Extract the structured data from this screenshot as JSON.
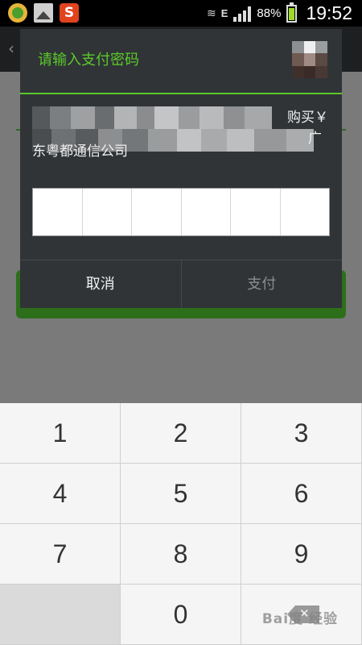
{
  "status_bar": {
    "network_type": "E",
    "battery_percent": "88%",
    "battery_level": 0.88,
    "time": "19:52",
    "notification_icons": [
      "app-green-circle-icon",
      "gallery-icon",
      "sogou-s-icon"
    ],
    "s_glyph": "S",
    "vibrate_glyph": "≋",
    "back_glyph": "‹"
  },
  "dialog": {
    "title": "请输入支付密码",
    "description_buy": "购买￥",
    "description_guang": "广",
    "description_line2": "东粤都通信公司",
    "pin_cells": [
      "",
      "",
      "",
      "",
      "",
      ""
    ],
    "cancel_label": "取消",
    "pay_label": "支付"
  },
  "keypad": {
    "keys": [
      "1",
      "2",
      "3",
      "4",
      "5",
      "6",
      "7",
      "8",
      "9",
      "",
      "0",
      ""
    ],
    "delete_icon": "backspace-icon"
  },
  "watermark": "Bai度 经验",
  "colors": {
    "accent_green": "#5bc92a",
    "dialog_bg": "#303437",
    "dim_overlay": "#7a7a7a",
    "confirm_button_bg": "#2d6e1a"
  }
}
